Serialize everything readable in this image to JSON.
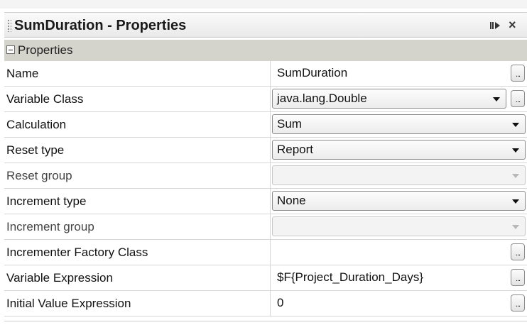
{
  "window": {
    "title": "SumDuration - Properties",
    "pin_icon": "pin-icon",
    "close_glyph": "×"
  },
  "section": {
    "label": "Properties",
    "icon": "collapse-icon"
  },
  "colors": {
    "header_bg": "#d4d3cc",
    "grid": "#d6d6d6"
  },
  "rows": [
    {
      "name": "Name",
      "kind": "text",
      "value": "SumDuration",
      "ellipsis": "..."
    },
    {
      "name": "Variable Class",
      "kind": "combo",
      "value": "java.lang.Double",
      "ellipsis": "..."
    },
    {
      "name": "Calculation",
      "kind": "combo",
      "value": "Sum"
    },
    {
      "name": "Reset type",
      "kind": "combo",
      "value": "Report"
    },
    {
      "name": "Reset group",
      "kind": "combo-disabled",
      "value": ""
    },
    {
      "name": "Increment type",
      "kind": "combo",
      "value": "None"
    },
    {
      "name": "Increment group",
      "kind": "combo-disabled",
      "value": ""
    },
    {
      "name": "Incrementer Factory Class",
      "kind": "text",
      "value": "",
      "ellipsis": "..."
    },
    {
      "name": "Variable Expression",
      "kind": "text",
      "value": "$F{Project_Duration_Days}",
      "ellipsis": "..."
    },
    {
      "name": "Initial Value Expression",
      "kind": "text",
      "value": "0",
      "ellipsis": "..."
    }
  ]
}
